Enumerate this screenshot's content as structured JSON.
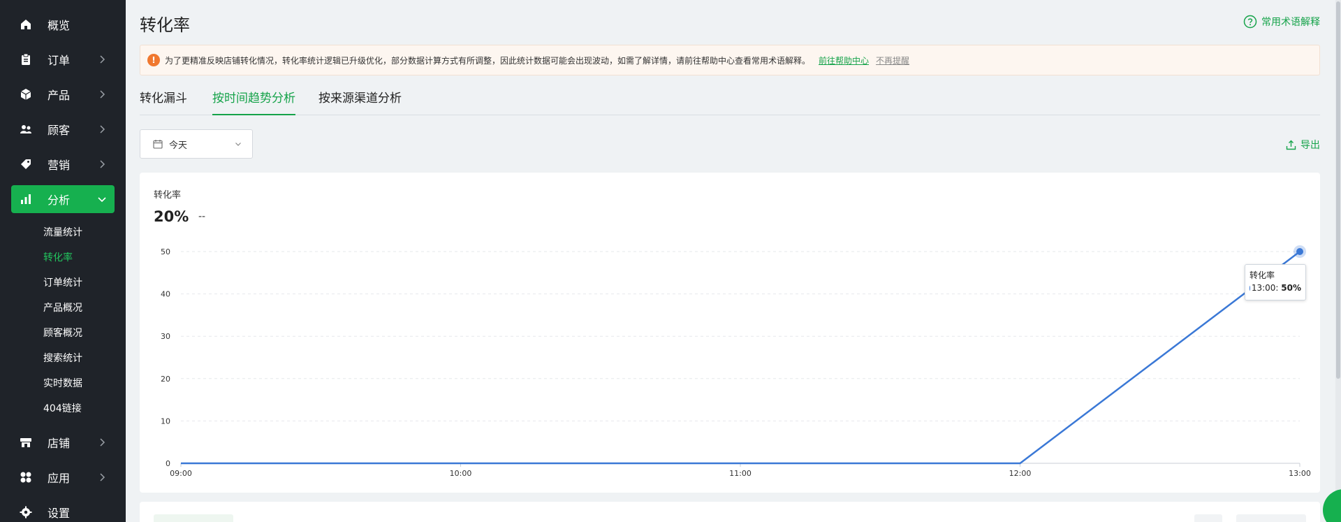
{
  "sidebar": {
    "items": [
      {
        "label": "概览",
        "icon": "home-icon"
      },
      {
        "label": "订单",
        "icon": "clipboard-icon"
      },
      {
        "label": "产品",
        "icon": "box-icon"
      },
      {
        "label": "顾客",
        "icon": "users-icon"
      },
      {
        "label": "营销",
        "icon": "tag-icon"
      },
      {
        "label": "分析",
        "icon": "bar-chart-icon",
        "active": true
      },
      {
        "label": "店铺",
        "icon": "store-icon"
      },
      {
        "label": "应用",
        "icon": "apps-icon"
      },
      {
        "label": "设置",
        "icon": "gear-icon"
      }
    ],
    "analysis_sub": [
      {
        "label": "流量统计"
      },
      {
        "label": "转化率",
        "active": true
      },
      {
        "label": "订单统计"
      },
      {
        "label": "产品概况"
      },
      {
        "label": "顾客概况"
      },
      {
        "label": "搜索统计"
      },
      {
        "label": "实时数据"
      },
      {
        "label": "404链接"
      }
    ]
  },
  "header": {
    "title": "转化率",
    "help_label": "常用术语解释"
  },
  "notice": {
    "text": "为了更精准反映店铺转化情况，转化率统计逻辑已升级优化，部分数据计算方式有所调整，因此统计数据可能会出现波动，如需了解详情，请前往帮助中心查看常用术语解释。",
    "link_help": "前往帮助中心",
    "link_dismiss": "不再提醒"
  },
  "tabs": [
    {
      "label": "转化漏斗"
    },
    {
      "label": "按时间趋势分析",
      "active": true
    },
    {
      "label": "按来源渠道分析"
    }
  ],
  "filter": {
    "date_value": "今天",
    "export_label": "导出"
  },
  "metric": {
    "label": "转化率",
    "value": "20%",
    "compare": "--"
  },
  "colors": {
    "accent": "#16a34a",
    "sidebar_bg": "#1f2329",
    "line": "#3a78d6",
    "notice_icon": "#f0782f"
  },
  "chart_data": {
    "type": "line",
    "x": [
      "09:00",
      "10:00",
      "11:00",
      "12:00",
      "13:00"
    ],
    "series": [
      {
        "name": "转化率",
        "values": [
          0,
          0,
          0,
          0,
          50
        ]
      }
    ],
    "ylim": [
      0,
      50
    ],
    "yticks": [
      0,
      10,
      20,
      30,
      40,
      50
    ],
    "grid": true,
    "tooltip": {
      "title": "转化率",
      "x": "13:00",
      "value": "50%"
    }
  }
}
